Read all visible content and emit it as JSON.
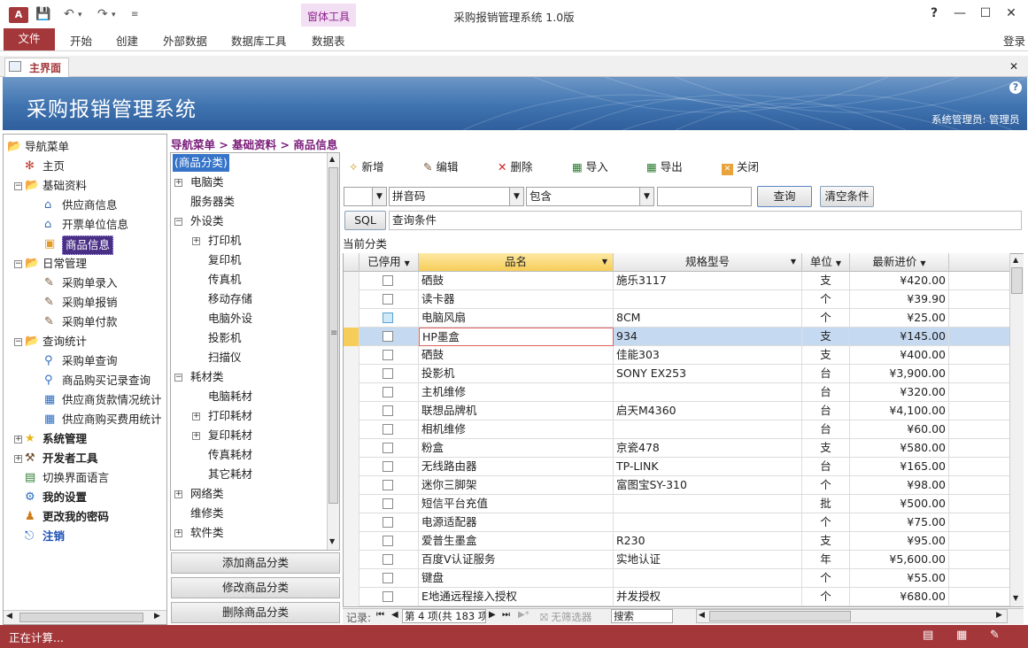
{
  "app": {
    "title": "采购报销管理系统 1.0版",
    "logo": "A",
    "login": "登录"
  },
  "ribbon": {
    "file": "文件",
    "tabs": [
      "开始",
      "创建",
      "外部数据",
      "数据库工具",
      "数据表"
    ],
    "context_group": "窗体工具"
  },
  "doc_tab": {
    "label": "主界面"
  },
  "banner": {
    "title": "采购报销管理系统",
    "user": "系统管理员: 管理员"
  },
  "nav": {
    "items": [
      {
        "label": "导航菜单",
        "icon": "folder-open-icon",
        "level": 0,
        "bold": false
      },
      {
        "label": "主页",
        "icon": "bug-icon",
        "level": 1
      },
      {
        "label": "基础资料",
        "icon": "folder-open-icon",
        "level": 1,
        "expand": "minus"
      },
      {
        "label": "供应商信息",
        "icon": "house-icon",
        "level": 2
      },
      {
        "label": "开票单位信息",
        "icon": "house-icon",
        "level": 2
      },
      {
        "label": "商品信息",
        "icon": "box-icon",
        "level": 2,
        "selected": true
      },
      {
        "label": "日常管理",
        "icon": "folder-open-icon",
        "level": 1,
        "expand": "minus"
      },
      {
        "label": "采购单录入",
        "icon": "pen-icon",
        "level": 2
      },
      {
        "label": "采购单报销",
        "icon": "pen-icon",
        "level": 2
      },
      {
        "label": "采购单付款",
        "icon": "pen-icon",
        "level": 2
      },
      {
        "label": "查询统计",
        "icon": "folder-open-icon",
        "level": 1,
        "expand": "minus"
      },
      {
        "label": "采购单查询",
        "icon": "magnifier-icon",
        "level": 2
      },
      {
        "label": "商品购买记录查询",
        "icon": "magnifier-icon",
        "level": 2
      },
      {
        "label": "供应商货款情况统计",
        "icon": "bar-chart-icon",
        "level": 2
      },
      {
        "label": "供应商购买费用统计",
        "icon": "bar-chart-icon",
        "level": 2
      },
      {
        "label": "系统管理",
        "icon": "star-icon",
        "level": 1,
        "expand": "plus",
        "bold": true
      },
      {
        "label": "开发者工具",
        "icon": "tools-icon",
        "level": 1,
        "expand": "plus",
        "bold": true
      },
      {
        "label": "切换界面语言",
        "icon": "language-icon",
        "level": 1
      },
      {
        "label": "我的设置",
        "icon": "settings-icon",
        "level": 1,
        "bold": true
      },
      {
        "label": "更改我的密码",
        "icon": "user-key-icon",
        "level": 1,
        "bold": true
      },
      {
        "label": "注销",
        "icon": "logout-icon",
        "level": 1,
        "bold": true,
        "blue": true
      }
    ]
  },
  "breadcrumb": "导航菜单 > 基础资料 > 商品信息",
  "categories": {
    "items": [
      {
        "label": "(商品分类)",
        "level": 0,
        "selected": true
      },
      {
        "label": "电脑类",
        "level": 0,
        "expand": "plus"
      },
      {
        "label": "服务器类",
        "level": 0
      },
      {
        "label": "外设类",
        "level": 0,
        "expand": "minus"
      },
      {
        "label": "打印机",
        "level": 1,
        "expand": "plus"
      },
      {
        "label": "复印机",
        "level": 1
      },
      {
        "label": "传真机",
        "level": 1
      },
      {
        "label": "移动存储",
        "level": 1
      },
      {
        "label": "电脑外设",
        "level": 1
      },
      {
        "label": "投影机",
        "level": 1
      },
      {
        "label": "扫描仪",
        "level": 1
      },
      {
        "label": "耗材类",
        "level": 0,
        "expand": "minus"
      },
      {
        "label": "电脑耗材",
        "level": 1
      },
      {
        "label": "打印耗材",
        "level": 1,
        "expand": "plus"
      },
      {
        "label": "复印耗材",
        "level": 1,
        "expand": "plus"
      },
      {
        "label": "传真耗材",
        "level": 1
      },
      {
        "label": "其它耗材",
        "level": 1
      },
      {
        "label": "网络类",
        "level": 0,
        "expand": "plus"
      },
      {
        "label": "维修类",
        "level": 0
      },
      {
        "label": "软件类",
        "level": 0,
        "expand": "plus"
      }
    ],
    "add": "添加商品分类",
    "edit": "修改商品分类",
    "delete": "删除商品分类"
  },
  "toolbar": {
    "new": "新增",
    "edit": "编辑",
    "delete": "删除",
    "import": "导入",
    "export": "导出",
    "close": "关闭"
  },
  "search": {
    "field": "拼音码",
    "op": "包含",
    "value": "",
    "query": "查询",
    "clear": "清空条件",
    "sql": "SQL",
    "cond_label": "查询条件",
    "current": "当前分类"
  },
  "grid": {
    "headers": [
      "已停用",
      "品名",
      "规格型号",
      "单位",
      "最新进价"
    ],
    "rows": [
      [
        "硒鼓",
        "施乐3117",
        "支",
        "¥420.00"
      ],
      [
        "读卡器",
        "",
        "个",
        "¥39.90"
      ],
      [
        "电脑风扇",
        "8CM",
        "个",
        "¥25.00"
      ],
      [
        "HP墨盒",
        "934",
        "支",
        "¥145.00"
      ],
      [
        "硒鼓",
        "佳能303",
        "支",
        "¥400.00"
      ],
      [
        "投影机",
        "SONY EX253",
        "台",
        "¥3,900.00"
      ],
      [
        "主机维修",
        "",
        "台",
        "¥320.00"
      ],
      [
        "联想品牌机",
        "启天M4360",
        "台",
        "¥4,100.00"
      ],
      [
        "相机维修",
        "",
        "台",
        "¥60.00"
      ],
      [
        "粉盒",
        "京瓷478",
        "支",
        "¥580.00"
      ],
      [
        "无线路由器",
        "TP-LINK",
        "台",
        "¥165.00"
      ],
      [
        "迷你三脚架",
        "富图宝SY-310",
        "个",
        "¥98.00"
      ],
      [
        "短信平台充值",
        "",
        "批",
        "¥500.00"
      ],
      [
        "电源适配器",
        "",
        "个",
        "¥75.00"
      ],
      [
        "爱普生墨盒",
        "R230",
        "支",
        "¥95.00"
      ],
      [
        "百度V认证服务",
        "实地认证",
        "年",
        "¥5,600.00"
      ],
      [
        "键盘",
        "",
        "个",
        "¥55.00"
      ],
      [
        "E地通远程接入授权",
        "并发授权",
        "个",
        "¥680.00"
      ]
    ]
  },
  "recnav": {
    "label": "记录:",
    "position": "第 4 项(共 183 项",
    "filter": "无筛选器",
    "search": "搜索"
  },
  "status": {
    "text": "正在计算..."
  }
}
